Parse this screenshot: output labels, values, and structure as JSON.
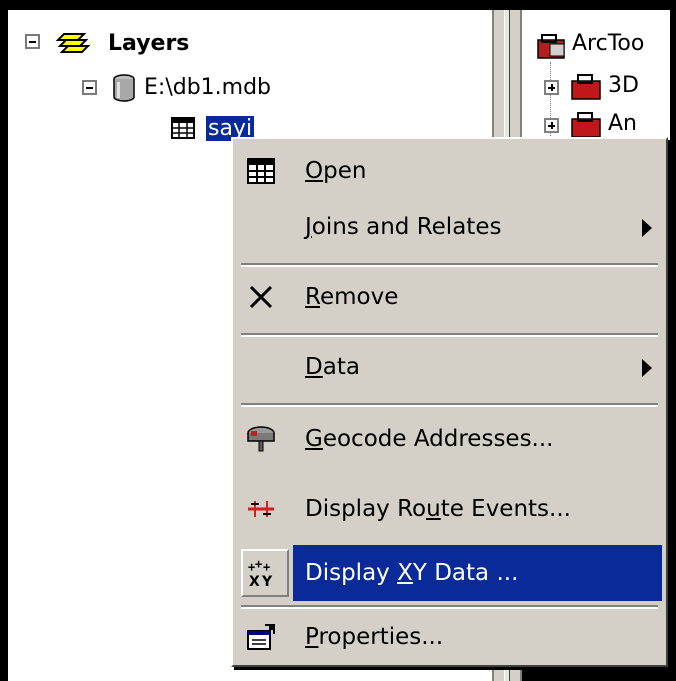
{
  "tree": {
    "root_label": "Layers",
    "db_label": "E:\\db1.mdb",
    "table_label": "sayi"
  },
  "toolbox": {
    "root_label": "ArcToo",
    "item1_label": "3D",
    "item2_label": "An"
  },
  "menu": {
    "items": [
      {
        "pre": "",
        "mn": "O",
        "post": "pen",
        "icon": "table-icon",
        "submenu": false
      },
      {
        "pre": "",
        "mn": "J",
        "post": "oins and Relates",
        "icon": "",
        "submenu": true
      },
      {
        "pre": "",
        "mn": "R",
        "post": "emove",
        "icon": "remove-x-icon",
        "submenu": false
      },
      {
        "pre": "",
        "mn": "D",
        "post": "ata",
        "icon": "",
        "submenu": true
      },
      {
        "pre": "",
        "mn": "G",
        "post": "eocode Addresses...",
        "icon": "geocode-mailbox-icon",
        "submenu": false
      },
      {
        "pre": "Display Ro",
        "mn": "u",
        "post": "te Events...",
        "icon": "route-events-icon",
        "submenu": false
      },
      {
        "pre": "Display ",
        "mn": "X",
        "post": "Y Data ...",
        "icon": "xy-data-icon",
        "submenu": false,
        "highlighted": true
      },
      {
        "pre": "",
        "mn": "P",
        "post": "roperties...",
        "icon": "properties-icon",
        "submenu": false
      }
    ]
  },
  "colors": {
    "selection": "#0a2a9a",
    "menu_face": "#d4d0c8"
  }
}
